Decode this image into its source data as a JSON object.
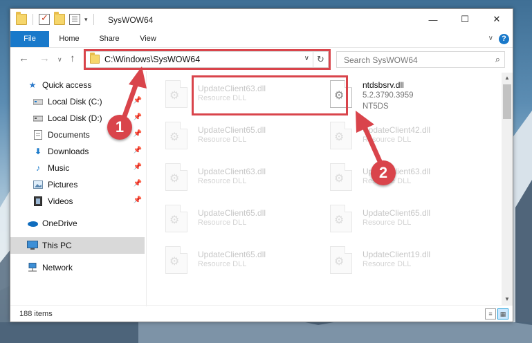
{
  "window": {
    "title": "SysWOW64"
  },
  "ribbon": {
    "tabs": [
      "File",
      "Home",
      "Share",
      "View"
    ],
    "help": "?"
  },
  "nav": {
    "back": "←",
    "forward": "→",
    "recent": "∨",
    "up": "↑"
  },
  "address": {
    "path": "C:\\Windows\\SysWOW64",
    "refresh": "↻"
  },
  "search": {
    "placeholder": "Search SysWOW64"
  },
  "sidebar": {
    "items": [
      {
        "label": "Quick access",
        "icon": "star-icon",
        "pinned": false
      },
      {
        "label": "Local Disk (C:)",
        "icon": "drive-icon",
        "pinned": true
      },
      {
        "label": "Local Disk (D:)",
        "icon": "drive-icon",
        "pinned": true
      },
      {
        "label": "Documents",
        "icon": "documents-icon",
        "pinned": true
      },
      {
        "label": "Downloads",
        "icon": "downloads-icon",
        "pinned": true
      },
      {
        "label": "Music",
        "icon": "music-icon",
        "pinned": true
      },
      {
        "label": "Pictures",
        "icon": "pictures-icon",
        "pinned": true
      },
      {
        "label": "Videos",
        "icon": "videos-icon",
        "pinned": true
      },
      {
        "label": "OneDrive",
        "icon": "onedrive-icon",
        "pinned": false
      },
      {
        "label": "This PC",
        "icon": "computer-icon",
        "pinned": false,
        "selected": true
      },
      {
        "label": "Network",
        "icon": "network-icon",
        "pinned": false
      }
    ]
  },
  "files": {
    "left_column": [
      {
        "name": "UpdateClient63.dll",
        "type": "Resource DLL"
      },
      {
        "name": "UpdateClient65.dll",
        "type": "Resource DLL"
      },
      {
        "name": "UpdateClient63.dll",
        "type": "Resource DLL"
      },
      {
        "name": "UpdateClient65.dll",
        "type": "Resource DLL"
      },
      {
        "name": "UpdateClient65.dll",
        "type": "Resource DLL"
      }
    ],
    "right_column": [
      {
        "name": "ntdsbsrv.dll",
        "version": "5.2.3790.3959",
        "company": "NT5DS"
      },
      {
        "name": "UpdateClient42.dll",
        "type": "Resource DLL"
      },
      {
        "name": "UpdateClient63.dll",
        "type": "Resource DLL"
      },
      {
        "name": "UpdateClient65.dll",
        "type": "Resource DLL"
      },
      {
        "name": "UpdateClient19.dll",
        "type": "Resource DLL"
      }
    ]
  },
  "status": {
    "item_count": "188 items"
  },
  "callouts": [
    "1",
    "2"
  ],
  "colors": {
    "accent": "#1979ca",
    "highlight": "#d9444b",
    "selected_nav": "#d9d9d9"
  }
}
